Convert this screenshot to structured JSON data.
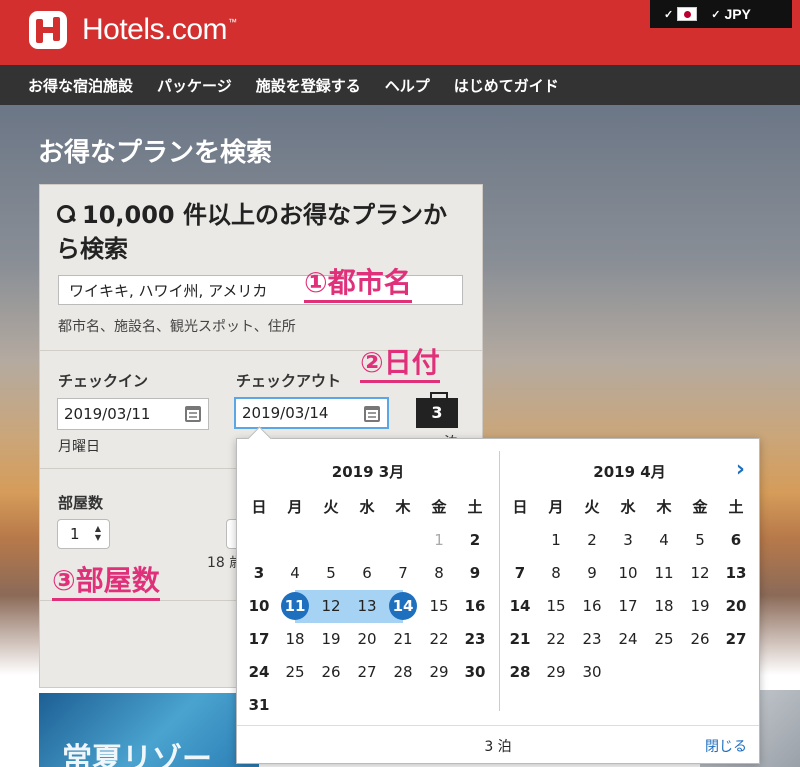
{
  "header": {
    "logo_text": "Hotels.com",
    "logo_tm": "™",
    "currency": "JPY",
    "brand_color": "#d32f2f"
  },
  "nav": [
    "お得な宿泊施設",
    "パッケージ",
    "施設を登録する",
    "ヘルプ",
    "はじめてガイド"
  ],
  "hero": {
    "title": "お得なプランを検索"
  },
  "search": {
    "heading": "10,000 件以上のお得なプランから検索",
    "destination_value": "ワイキキ, ハワイ州, アメリカ",
    "destination_hint": "都市名、施設名、観光スポット、住所",
    "checkin_label": "チェックイン",
    "checkin_value": "2019/03/11",
    "checkin_day": "月曜日",
    "checkout_label": "チェックアウト",
    "checkout_value": "2019/03/14",
    "nights": "3",
    "nights_suffix": "泊",
    "rooms_label": "部屋数",
    "rooms_value": "1",
    "age_fragment": "18 歳"
  },
  "annotations": {
    "city": "①都市名",
    "date": "②日付",
    "rooms": "③部屋数",
    "color": "#e0307a"
  },
  "promo": {
    "text": "常夏リゾー"
  },
  "calendar": {
    "weekdays": [
      "日",
      "月",
      "火",
      "水",
      "木",
      "金",
      "土"
    ],
    "months": [
      {
        "title": "2019 3月",
        "lead_blanks": 5,
        "days": 31,
        "past_days": [
          1
        ],
        "range_start": 11,
        "range_end": 14
      },
      {
        "title": "2019 4月",
        "lead_blanks": 1,
        "days": 30,
        "past_days": [],
        "range_start": null,
        "range_end": null
      }
    ],
    "footer_nights": "3 泊",
    "close_label": "閉じる",
    "next_icon": "chevron-right-icon"
  }
}
